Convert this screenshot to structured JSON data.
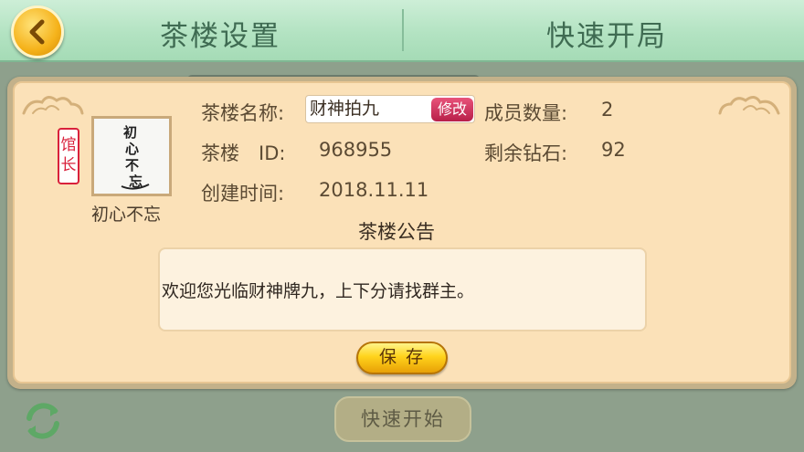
{
  "header": {
    "tab_settings": "茶楼设置",
    "tab_quick": "快速开局"
  },
  "owner": {
    "badge": "馆长",
    "name": "初心不忘",
    "avatar_text": "初心不忘"
  },
  "info": {
    "name_label": "茶楼名称:",
    "name_value": "财神拍九",
    "edit_label": "修改",
    "id_label": "茶楼　ID:",
    "id_value": "968955",
    "created_label": "创建时间:",
    "created_value": "2018.11.11",
    "members_label": "成员数量:",
    "members_value": "2",
    "diamonds_label": "剩余钻石:",
    "diamonds_value": "92"
  },
  "notice": {
    "title": "茶楼公告",
    "text": "欢迎您光临财神牌九，上下分请找群主。"
  },
  "buttons": {
    "save": "保存",
    "quick_start": "快速开始"
  },
  "colors": {
    "header_bg": "#b3e3c2",
    "panel_bg": "#fbe1b8",
    "accent_gold": "#f5b21a",
    "edit_red": "#d9214b"
  }
}
